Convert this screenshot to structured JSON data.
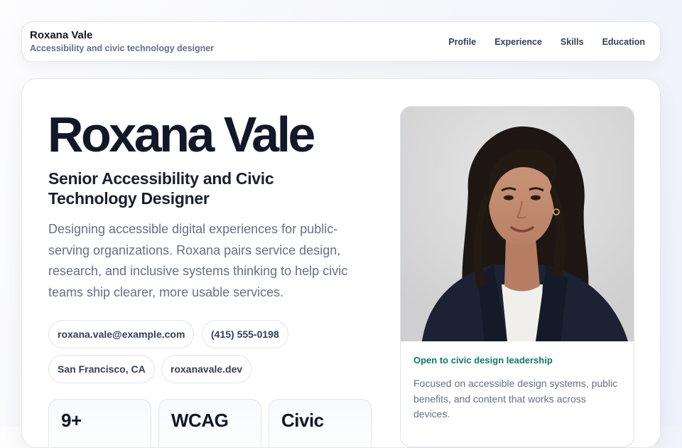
{
  "header": {
    "name": "Roxana Vale",
    "tagline": "Accessibility and civic technology designer",
    "nav": [
      {
        "label": "Profile"
      },
      {
        "label": "Experience"
      },
      {
        "label": "Skills"
      },
      {
        "label": "Education"
      }
    ]
  },
  "hero": {
    "name": "Roxana Vale",
    "title": "Senior Accessibility and Civic Technology Designer",
    "summary": "Designing accessible digital experiences for public-serving organizations. Roxana pairs service design, research, and inclusive systems thinking to help civic teams ship clearer, more usable services.",
    "contacts": {
      "email": "roxana.vale@example.com",
      "phone": "(415) 555-0198",
      "location": "San Francisco, CA",
      "website": "roxanavale.dev"
    },
    "stats": [
      {
        "value": "9+"
      },
      {
        "value": "WCAG"
      },
      {
        "value": "Civic"
      }
    ]
  },
  "profile_card": {
    "photo_icon": "portrait-photo",
    "availability": "Open to civic design leadership",
    "focus": "Focused on accessible design systems, public benefits, and content that works across devices."
  },
  "colors": {
    "accent_green": "#0f7a64",
    "heading": "#111827",
    "muted_text": "#667085",
    "border": "#e4e7ee"
  }
}
